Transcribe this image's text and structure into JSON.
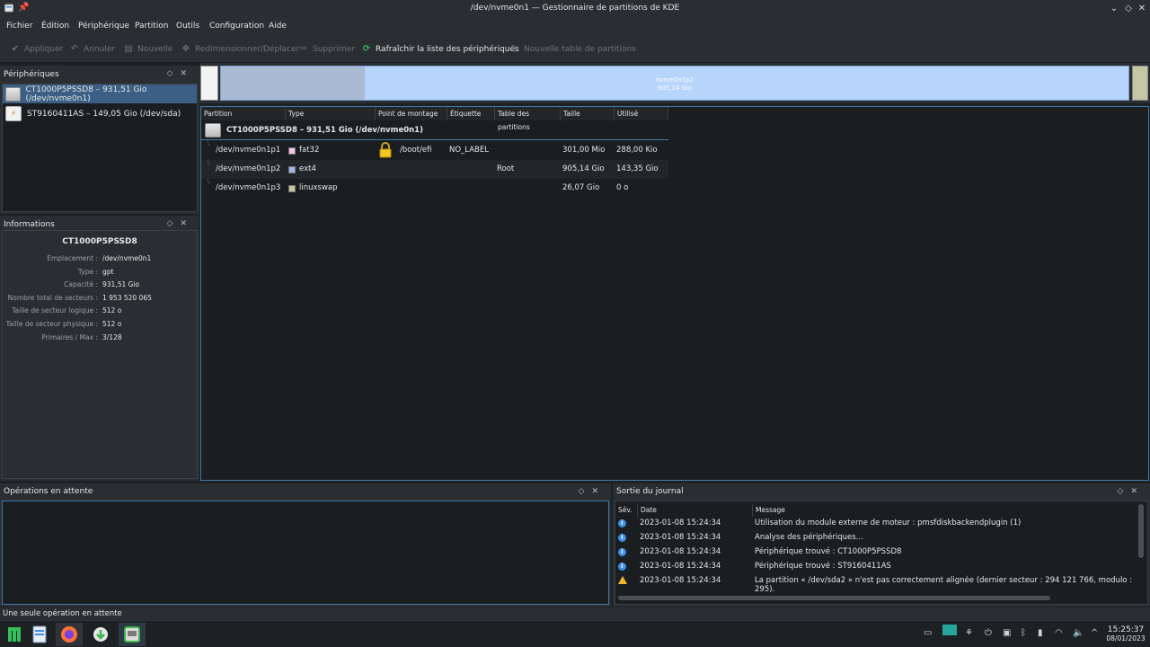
{
  "window": {
    "title": "/dev/nvme0n1 — Gestionnaire de partitions de KDE"
  },
  "menu": [
    "Fichier",
    "Édition",
    "Périphérique",
    "Partition",
    "Outils",
    "Configuration",
    "Aide"
  ],
  "toolbar": {
    "apply": "Appliquer",
    "undo": "Annuler",
    "new": "Nouvelle",
    "resize": "Redimensionner/Déplacer",
    "delete": "Supprimer",
    "refresh": "Rafraîchir la liste des périphériques",
    "new_table": "Nouvelle table de partitions"
  },
  "devices_panel": {
    "title": "Périphériques",
    "items": [
      "CT1000P5PSSD8 – 931,51 Gio (/dev/nvme0n1)",
      "ST9160411AS – 149,05 Gio (/dev/sda)"
    ]
  },
  "info_panel": {
    "title": "Informations",
    "device": "CT1000P5PSSD8",
    "rows": [
      {
        "k": "Emplacement :",
        "v": "/dev/nvme0n1"
      },
      {
        "k": "Type :",
        "v": "gpt"
      },
      {
        "k": "Capacité :",
        "v": "931,51 Gio"
      },
      {
        "k": "Nombre total de secteurs :",
        "v": "1 953 520 065"
      },
      {
        "k": "Taille de secteur logique :",
        "v": "512 o"
      },
      {
        "k": "Taille de secteur physique :",
        "v": "512 o"
      },
      {
        "k": "Primaires / Max :",
        "v": "3/128"
      }
    ]
  },
  "partition_bar": {
    "selected_label": "nvme0n1p2",
    "selected_size": "905,14 Gio",
    "used_fraction_p2": 0.158
  },
  "tree": {
    "columns": [
      "Partition",
      "Type",
      "Point de montage",
      "Étiquette",
      "Table des partitions",
      "Taille",
      "Utilisé"
    ],
    "device_row": "CT1000P5PSSD8 – 931,51 Gio (/dev/nvme0n1)",
    "rows": [
      {
        "partition": "/dev/nvme0n1p1",
        "type": "fat32",
        "type_color": "#f5c4e8",
        "mount": "/boot/efi",
        "label": "NO_LABEL",
        "flags": "",
        "size": "301,00 Mio",
        "used": "288,00 Kio"
      },
      {
        "partition": "/dev/nvme0n1p2",
        "type": "ext4",
        "type_color": "#9db8e2",
        "mount": "",
        "label": "",
        "flags": "Root",
        "size": "905,14 Gio",
        "used": "143,35 Gio"
      },
      {
        "partition": "/dev/nvme0n1p3",
        "type": "linuxswap",
        "type_color": "#c6c6a4",
        "mount": "",
        "label": "",
        "flags": "",
        "size": "26,07 Gio",
        "used": "0 o"
      }
    ]
  },
  "ops_panel": {
    "title": "Opérations en attente"
  },
  "log_panel": {
    "title": "Sortie du journal",
    "columns": [
      "Sév.",
      "Date",
      "Message"
    ],
    "rows": [
      {
        "sev": "info",
        "date": "2023-01-08 15:24:34",
        "msg": "Utilisation du module externe de moteur : pmsfdiskbackendplugin (1)"
      },
      {
        "sev": "info",
        "date": "2023-01-08 15:24:34",
        "msg": "Analyse des périphériques..."
      },
      {
        "sev": "info",
        "date": "2023-01-08 15:24:34",
        "msg": "Périphérique trouvé : CT1000P5PSSD8"
      },
      {
        "sev": "info",
        "date": "2023-01-08 15:24:34",
        "msg": "Périphérique trouvé : ST9160411AS"
      },
      {
        "sev": "warning",
        "date": "2023-01-08 15:24:34",
        "msg": "La partition « /dev/sda2 » n'est pas correctement alignée (dernier secteur : 294 121 766, modulo : 295)."
      }
    ]
  },
  "statusbar": {
    "text": "Une seule opération en attente"
  },
  "clock": {
    "time": "15:25:37",
    "date": "08/01/2023"
  },
  "colors": {
    "accent": "#3d7aa8",
    "selection": "#3b5f85",
    "p2_fill": "#b7d4fb",
    "p2_used": "#a9bad3"
  }
}
